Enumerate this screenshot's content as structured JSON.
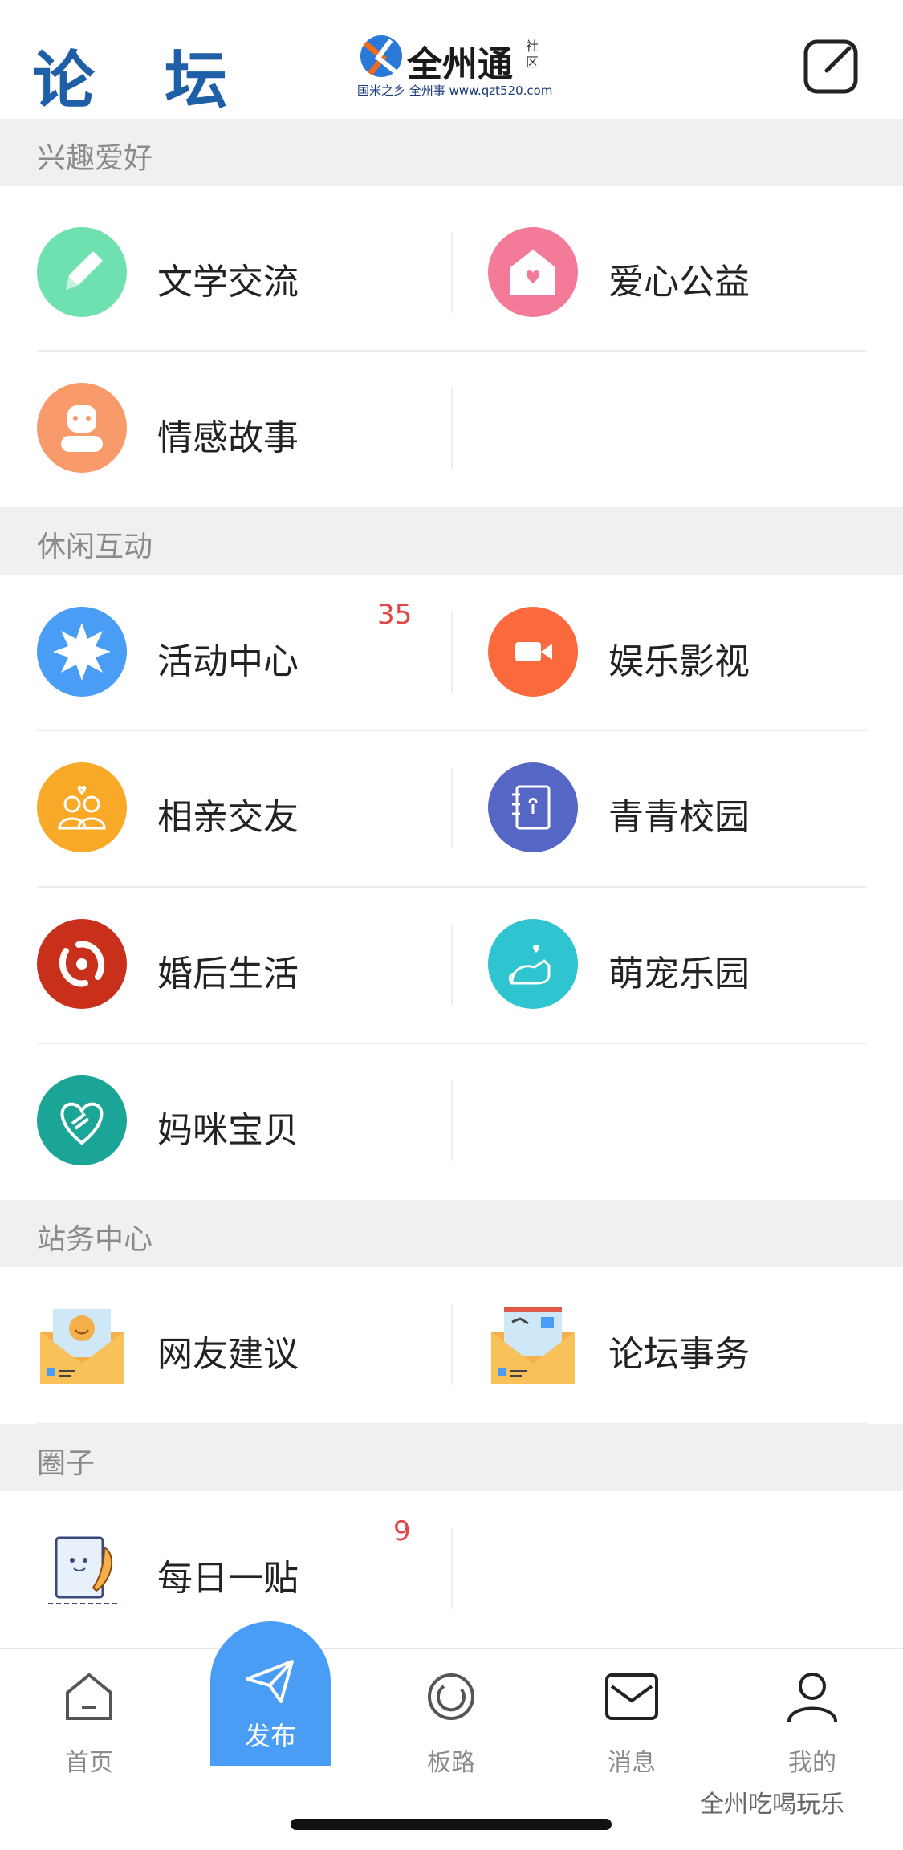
{
  "header": {
    "title": "论 坛",
    "logo_text": "全州通",
    "logo_tag": "社区",
    "logo_url": "国米之乡 全州事 www.qzt520.com"
  },
  "sections": [
    {
      "title": "兴趣爱好",
      "items": [
        {
          "label": "文学交流",
          "icon": "pencil-icon",
          "color": "#6fe0b0"
        },
        {
          "label": "爱心公益",
          "icon": "heart-house-icon",
          "color": "#f47a9a"
        },
        {
          "label": "情感故事",
          "icon": "person-icon",
          "color": "#f99a6a"
        }
      ]
    },
    {
      "title": "休闲互动",
      "items": [
        {
          "label": "活动中心",
          "icon": "sun-icon",
          "color": "#4a9df5",
          "badge": "35"
        },
        {
          "label": "娱乐影视",
          "icon": "video-icon",
          "color": "#fb6a3c"
        },
        {
          "label": "相亲交友",
          "icon": "couple-icon",
          "color": "#f9a928"
        },
        {
          "label": "青青校园",
          "icon": "notebook-icon",
          "color": "#5566c4"
        },
        {
          "label": "婚后生活",
          "icon": "family-icon",
          "color": "#c8301c"
        },
        {
          "label": "萌宠乐园",
          "icon": "cat-icon",
          "color": "#2ec4d0"
        },
        {
          "label": "妈咪宝贝",
          "icon": "hands-heart-icon",
          "color": "#1aa596"
        }
      ]
    },
    {
      "title": "站务中心",
      "items": [
        {
          "label": "网友建议",
          "icon": "smile-envelope-icon"
        },
        {
          "label": "论坛事务",
          "icon": "letter-envelope-icon"
        }
      ]
    },
    {
      "title": "圈子",
      "items": [
        {
          "label": "每日一贴",
          "icon": "paper-quill-icon",
          "badge": "9"
        }
      ]
    }
  ],
  "nav": {
    "home": "首页",
    "publish": "发布",
    "board": "板路",
    "messages": "消息",
    "me": "我的"
  },
  "watermark": "全州吃喝玩乐"
}
